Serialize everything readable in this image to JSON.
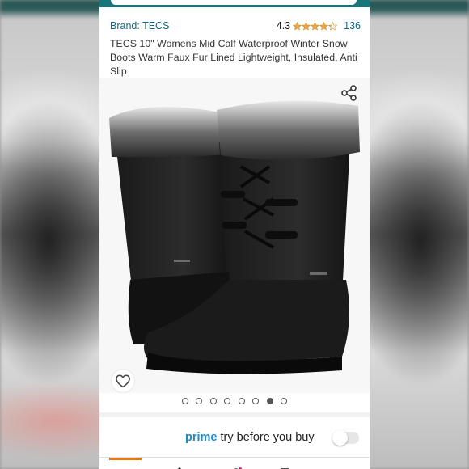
{
  "colors": {
    "header_teal": "#16767b",
    "link_blue": "#0f6a7e",
    "star_orange": "#f3a847",
    "prime_blue": "#1a8bc7",
    "nav_orange": "#e47911"
  },
  "product": {
    "brand": "Brand: TECS",
    "rating_value": "4.3",
    "rating_stars": 4.3,
    "review_count": "136",
    "title": "TECS 10\" Womens Mid Calf Waterproof Winter Snow Boots Warm Faux Fur Lined Lightweight, Insulated, Anti Slip"
  },
  "gallery": {
    "image_count": 8,
    "active_index": 6,
    "share_icon": "share-icon",
    "wishlist_icon": "heart-icon"
  },
  "prime": {
    "prime_label": "prime",
    "try_label": "try before you buy",
    "toggle_on": false
  }
}
